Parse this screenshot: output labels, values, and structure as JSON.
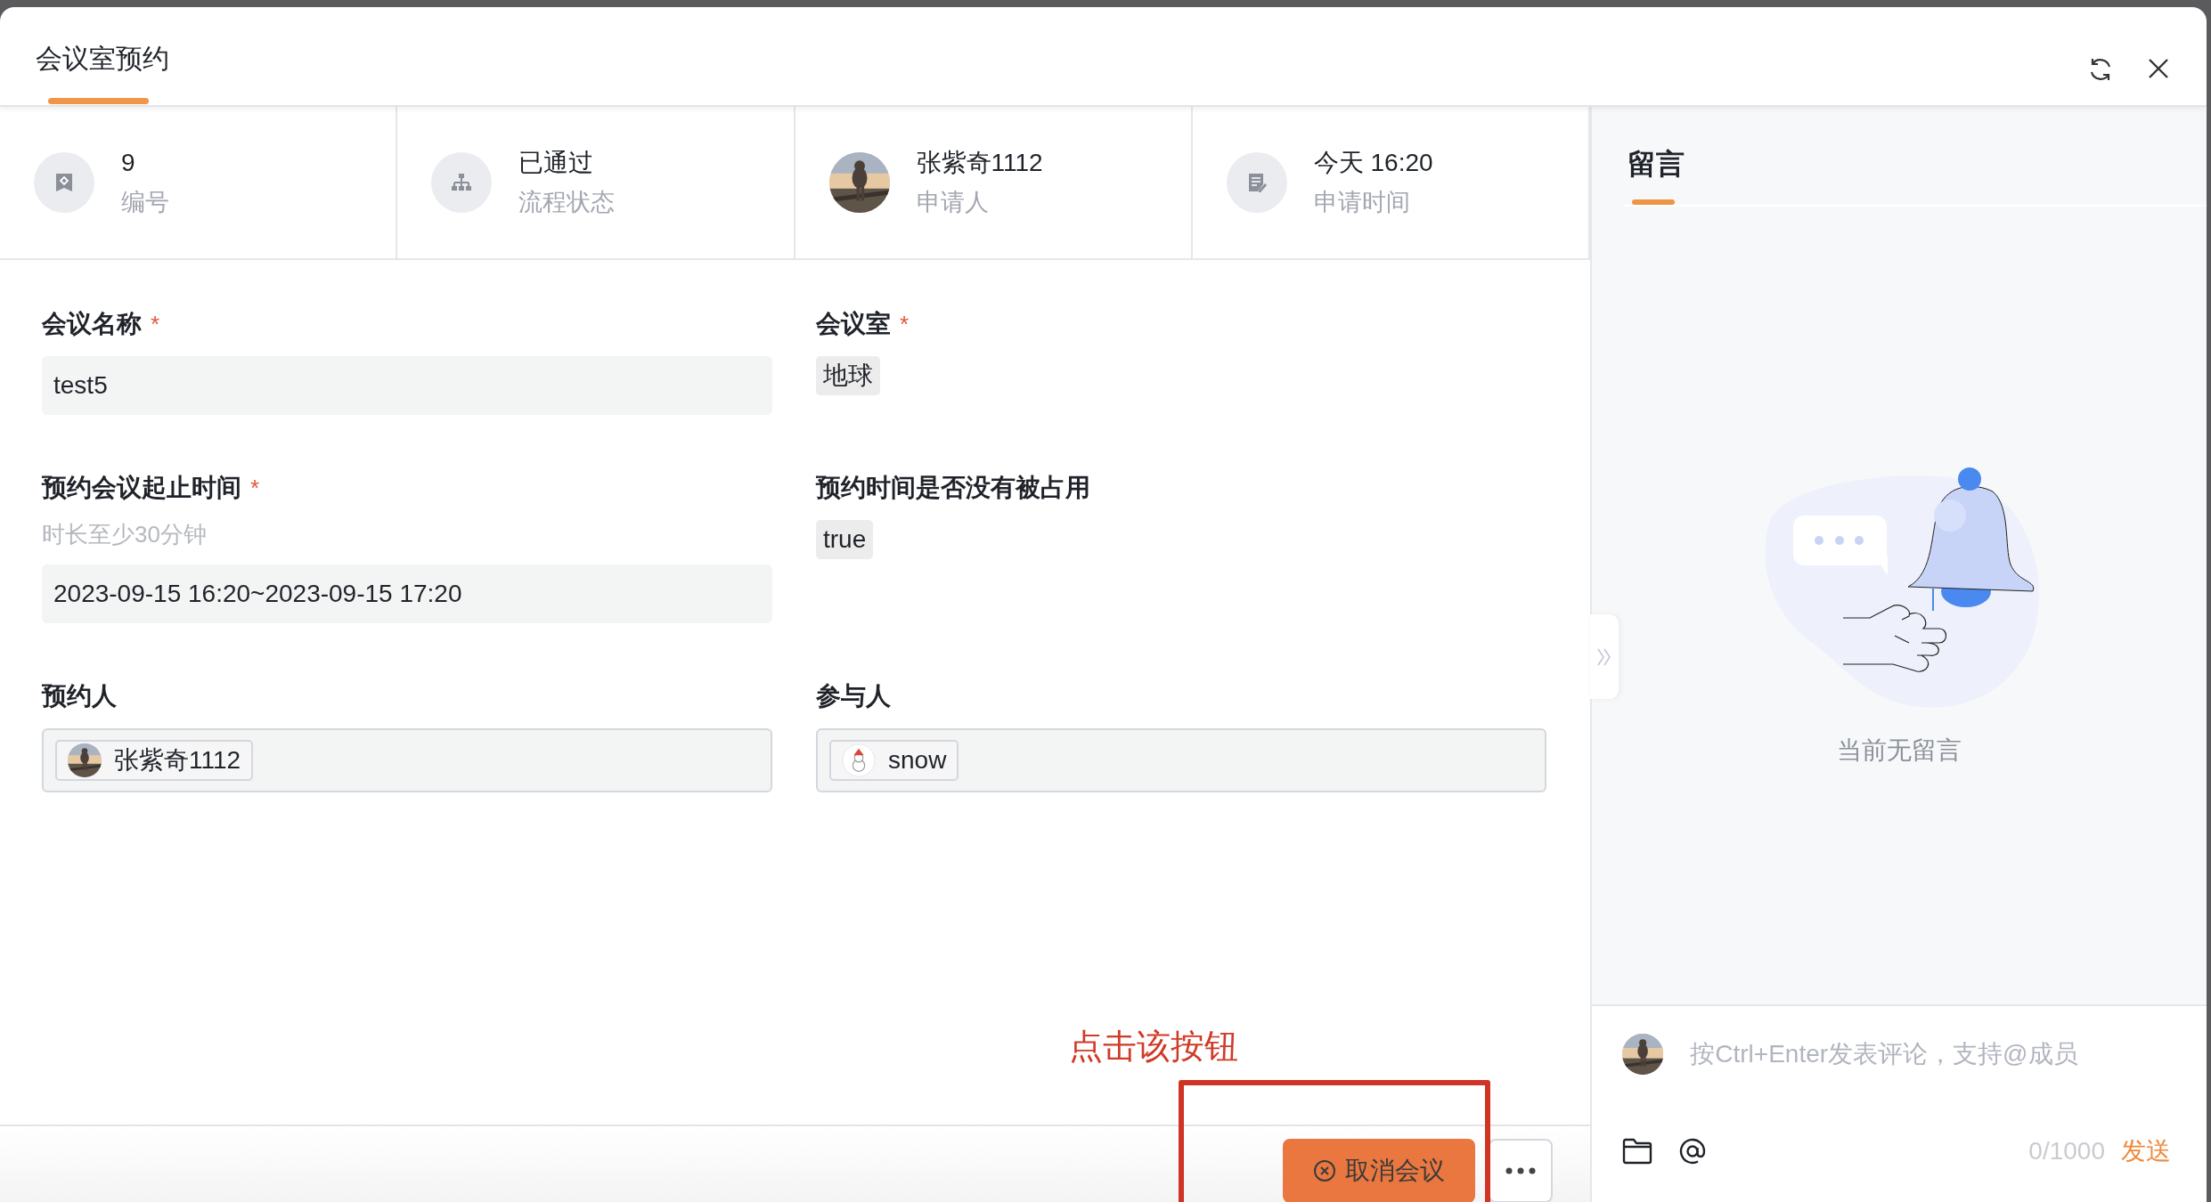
{
  "dialog": {
    "title": "会议室预约"
  },
  "info": [
    {
      "kind": "number",
      "value": "9",
      "label": "编号"
    },
    {
      "kind": "status",
      "value": "已通过",
      "label": "流程状态"
    },
    {
      "kind": "person",
      "value": "张紫奇1112",
      "label": "申请人"
    },
    {
      "kind": "time",
      "value": "今天 16:20",
      "label": "申请时间"
    }
  ],
  "form": {
    "fields": [
      {
        "kind": "input",
        "label": "会议名称",
        "required_mark": "*",
        "value": "test5"
      },
      {
        "kind": "tag",
        "label": "会议室",
        "required_mark": "*",
        "value": "地球"
      },
      {
        "kind": "input",
        "label": "预约会议起止时间",
        "required_mark": "*",
        "hint": "时长至少30分钟",
        "value": "2023-09-15 16:20~2023-09-15 17:20"
      },
      {
        "kind": "tag",
        "label": "预约时间是否没有被占用",
        "value": "true"
      },
      {
        "kind": "users",
        "label": "预约人",
        "users": [
          {
            "name": "张紫奇1112",
            "kind": "photo"
          }
        ]
      },
      {
        "kind": "users",
        "label": "参与人",
        "users": [
          {
            "name": "snow",
            "kind": "snowman"
          }
        ]
      }
    ]
  },
  "footer": {
    "buttons": [
      {
        "kind": "cancel",
        "label": "取消会议"
      },
      {
        "kind": "more"
      }
    ]
  },
  "annotation": {
    "text": "点击该按钮"
  },
  "comments": {
    "title": "留言",
    "empty_text": "当前无留言",
    "placeholder": "按Ctrl+Enter发表评论，支持@成员",
    "counter": "0/1000",
    "send": "发送"
  }
}
